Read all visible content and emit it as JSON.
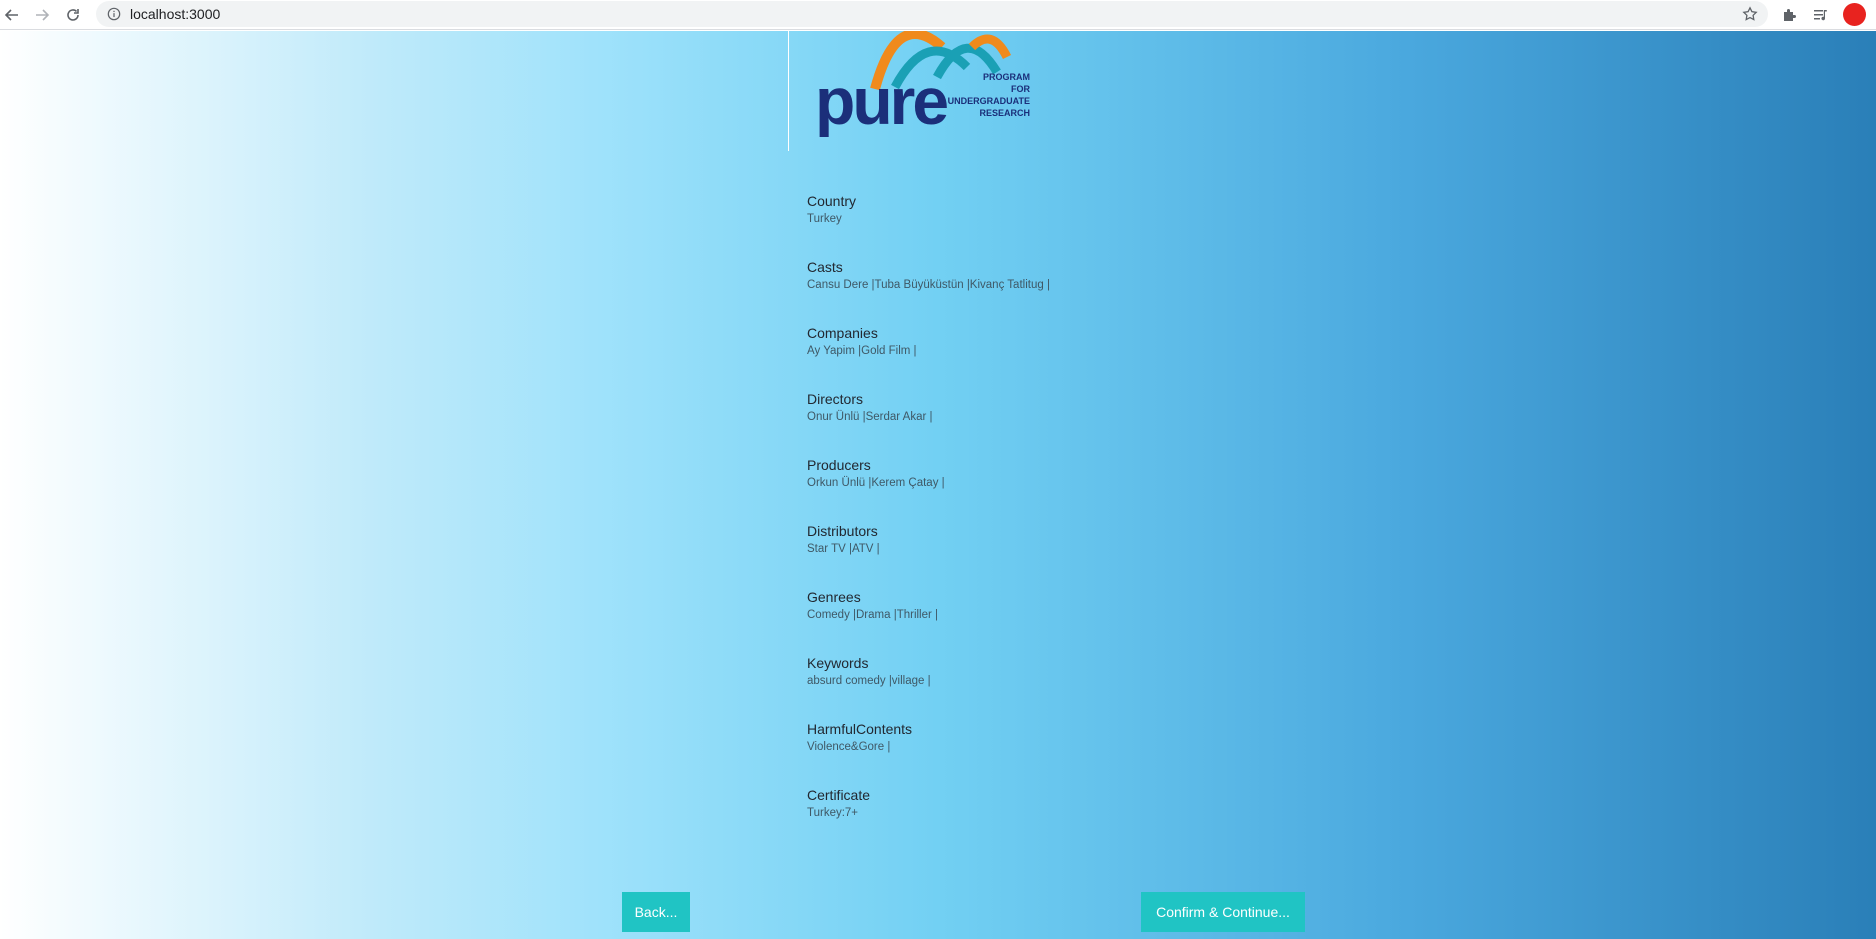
{
  "browser": {
    "url": "localhost:3000"
  },
  "logo": {
    "wordmark": "pure",
    "tagline": [
      "PROGRAM",
      "FOR",
      "UNDERGRADUATE",
      "RESEARCH"
    ]
  },
  "fields": [
    {
      "label": "Country",
      "value": "Turkey"
    },
    {
      "label": "Casts",
      "value": "Cansu Dere |Tuba Büyüküstün |Kivanç Tatlitug |"
    },
    {
      "label": "Companies",
      "value": "Ay Yapim |Gold Film |"
    },
    {
      "label": "Directors",
      "value": "Onur Ünlü |Serdar Akar |"
    },
    {
      "label": "Producers",
      "value": "Orkun Ünlü |Kerem Çatay |"
    },
    {
      "label": "Distributors",
      "value": "Star TV |ATV |"
    },
    {
      "label": "Genrees",
      "value": "Comedy |Drama |Thriller |"
    },
    {
      "label": "Keywords",
      "value": "absurd comedy |village |"
    },
    {
      "label": "HarmfulContents",
      "value": "Violence&Gore |"
    },
    {
      "label": "Certificate",
      "value": "Turkey:7+"
    }
  ],
  "buttons": {
    "back": "Back...",
    "confirm": "Confirm & Continue..."
  },
  "colors": {
    "button_bg": "#20c4c4",
    "logo_navy": "#1b2f7a",
    "logo_orange": "#f08a1c",
    "logo_teal": "#1aa0b5",
    "profile": "#e8231f"
  }
}
